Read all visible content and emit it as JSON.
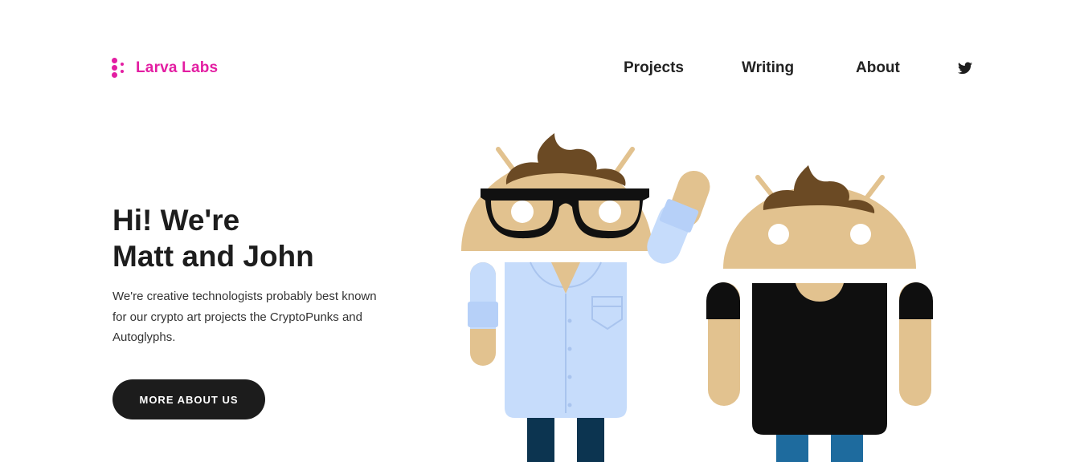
{
  "brand": {
    "name": "Larva Labs",
    "color": "#e31ea2"
  },
  "nav": {
    "items": [
      {
        "label": "Projects"
      },
      {
        "label": "Writing"
      },
      {
        "label": "About"
      }
    ],
    "social_icon": "twitter-icon"
  },
  "hero": {
    "title_line1": "Hi! We're",
    "title_line2": "Matt and John",
    "description": "We're creative technologists probably best known for our crypto art projects the CryptoPunks and Autoglyphs.",
    "cta_label": "MORE ABOUT US"
  },
  "illustration": {
    "figures": [
      "matt-android",
      "john-android"
    ],
    "colors": {
      "skin": "#e2c28f",
      "hair": "#6b4a24",
      "shirt_blue": "#c6dcfb",
      "shirt_black": "#0f0f0f",
      "pants_dark": "#0c3450",
      "pants_blue": "#1e6b9e"
    }
  }
}
